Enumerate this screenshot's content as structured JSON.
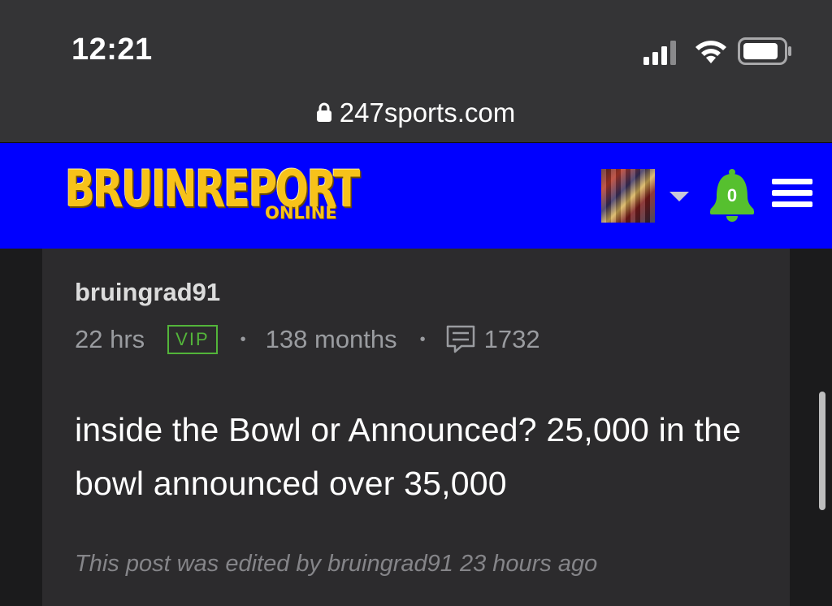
{
  "status_bar": {
    "time": "12:21"
  },
  "browser": {
    "url": "247sports.com"
  },
  "header": {
    "logo_main": "BRUINREPORT",
    "logo_sub": "ONLINE",
    "notification_count": "0",
    "header_color": "#0000ff",
    "logo_color": "#f7c21a",
    "bell_color": "#56c02f"
  },
  "post": {
    "username": "bruingrad91",
    "posted_ago": "22 hrs",
    "badge": "VIP",
    "member_duration": "138 months",
    "post_count": "1732",
    "body": "inside the Bowl or Announced? 25,000 in the bowl announced over 35,000",
    "edited_note": "This post was edited by bruingrad91 23 hours ago"
  },
  "icons": {
    "signal": "signal-icon",
    "wifi": "wifi-icon",
    "battery": "battery-icon",
    "lock": "lock-icon",
    "bell": "bell-icon",
    "menu": "hamburger-menu-icon",
    "caret": "caret-down-icon",
    "comment": "comment-icon"
  }
}
